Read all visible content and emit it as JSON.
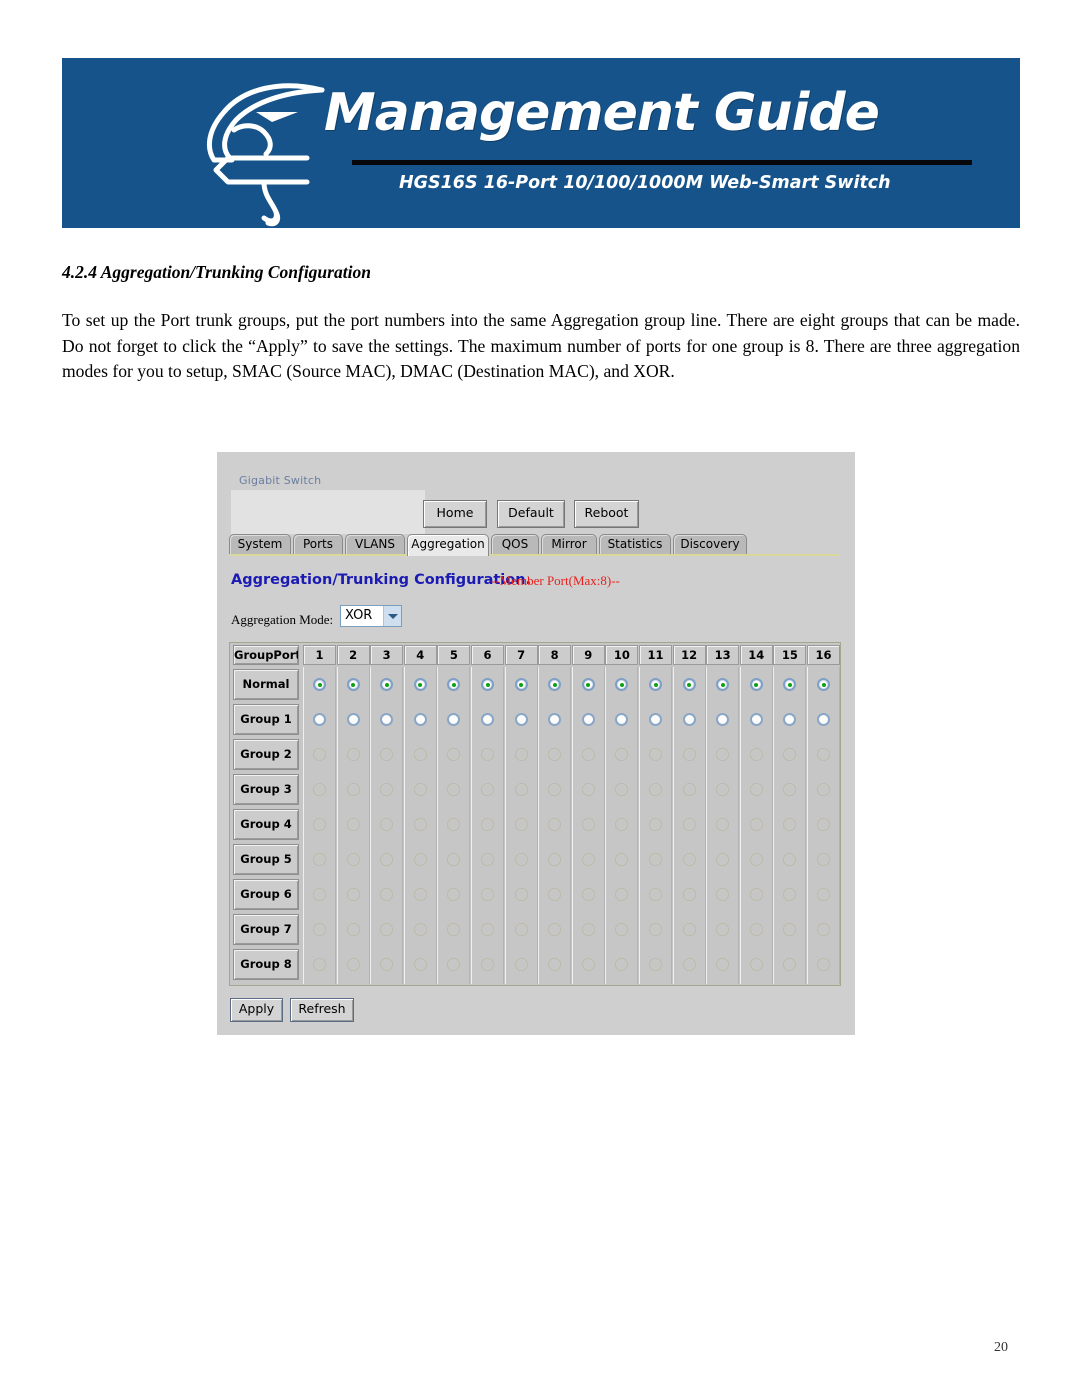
{
  "banner": {
    "title": "Management Guide",
    "subtitle": "HGS16S  16-Port 10/100/1000M Web-Smart Switch",
    "logo_name": "eagle-head-logo",
    "bg_color": "#15538a"
  },
  "document": {
    "heading": "4.2.4 Aggregation/Trunking Configuration",
    "paragraph": "To set up the Port trunk groups, put the port numbers into the same Aggregation group line. There are eight groups that can be made.  Do not forget to click the “Apply” to save the settings.  The maximum number of ports for one group is 8. There are three aggregation modes for you to setup, SMAC (Source MAC), DMAC (Destination MAC), and XOR.",
    "page_number": "20"
  },
  "switch_ui": {
    "brand_label": "Gigabit Switch",
    "top_buttons": [
      "Home",
      "Default",
      "Reboot"
    ],
    "tabs": [
      {
        "label": "System",
        "active": false
      },
      {
        "label": "Ports",
        "active": false
      },
      {
        "label": "VLANS",
        "active": false
      },
      {
        "label": "Aggregation",
        "active": true
      },
      {
        "label": "QOS",
        "active": false
      },
      {
        "label": "Mirror",
        "active": false
      },
      {
        "label": "Statistics",
        "active": false
      },
      {
        "label": "Discovery",
        "active": false
      }
    ],
    "config_title": "Aggregation/Trunking Configuration.",
    "config_title_note": "--Member Port(Max:8)--",
    "mode_label": "Aggregation Mode:",
    "mode_value": "XOR",
    "mode_options": [
      "SMAC",
      "DMAC",
      "XOR"
    ],
    "grid": {
      "corner_header": "GroupPort",
      "port_columns": [
        "1",
        "2",
        "3",
        "4",
        "5",
        "6",
        "7",
        "8",
        "9",
        "10",
        "11",
        "12",
        "13",
        "14",
        "15",
        "16"
      ],
      "rows": [
        {
          "label": "Normal",
          "state": "on"
        },
        {
          "label": "Group 1",
          "state": "off"
        },
        {
          "label": "Group 2",
          "state": "ghost"
        },
        {
          "label": "Group 3",
          "state": "ghost"
        },
        {
          "label": "Group 4",
          "state": "ghost"
        },
        {
          "label": "Group 5",
          "state": "ghost"
        },
        {
          "label": "Group 6",
          "state": "ghost"
        },
        {
          "label": "Group 7",
          "state": "ghost"
        },
        {
          "label": "Group 8",
          "state": "ghost"
        }
      ]
    },
    "bottom_buttons": [
      "Apply",
      "Refresh"
    ],
    "colors": {
      "title_blue": "#1b1bb4",
      "note_red": "#e8201e",
      "selected_dot_green": "#12a012",
      "panel_gray": "#cfcfcf"
    }
  }
}
